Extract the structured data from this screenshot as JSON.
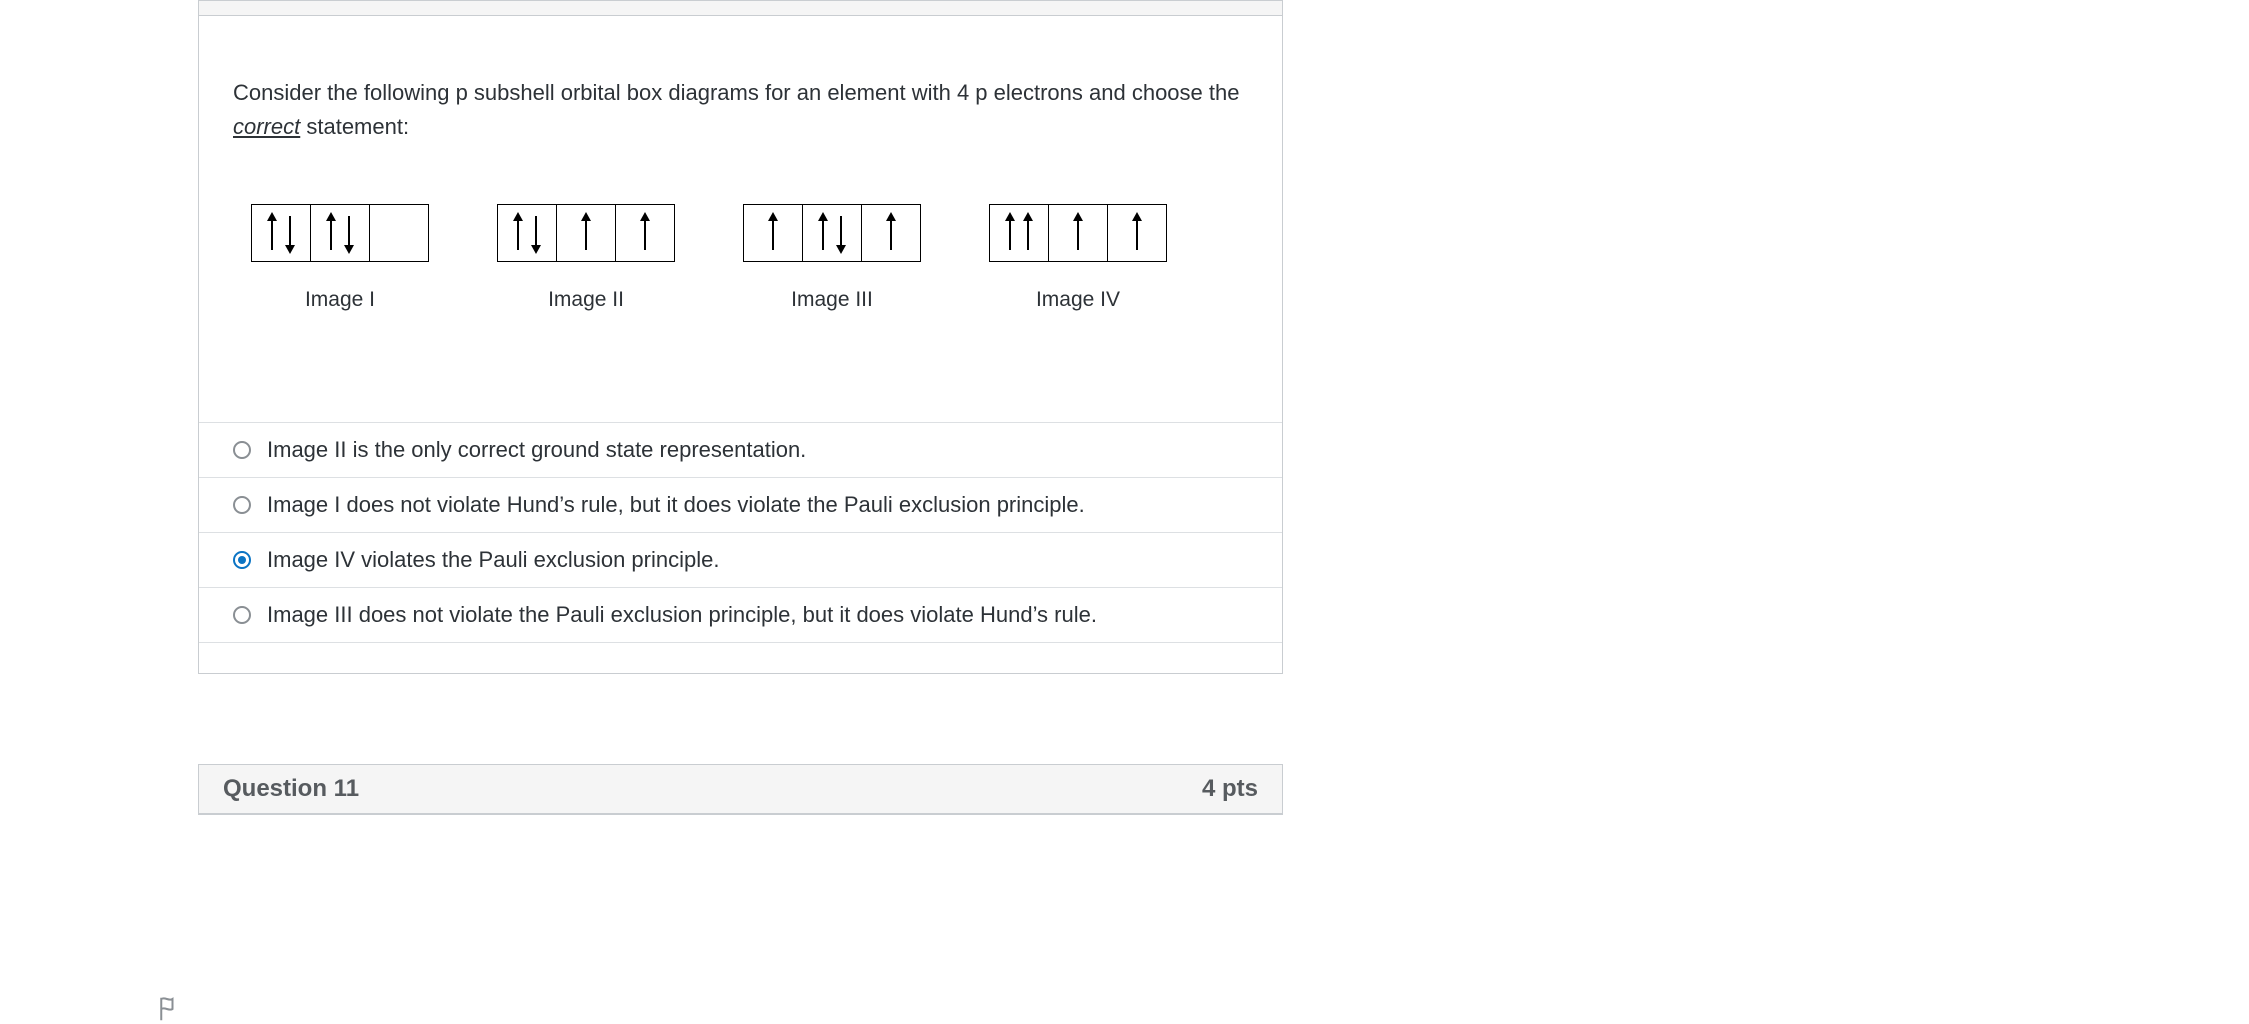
{
  "question": {
    "prompt_part1": "Consider the following p subshell orbital box diagrams for an element with 4 p electrons and choose the ",
    "prompt_emph": "correct",
    "prompt_part2": " statement:",
    "diagrams": [
      {
        "label": "Image I",
        "orbitals": [
          [
            "up",
            "down"
          ],
          [
            "up",
            "down"
          ],
          []
        ]
      },
      {
        "label": "Image II",
        "orbitals": [
          [
            "up",
            "down"
          ],
          [
            "up"
          ],
          [
            "up"
          ]
        ]
      },
      {
        "label": "Image III",
        "orbitals": [
          [
            "up"
          ],
          [
            "up",
            "down"
          ],
          [
            "up"
          ]
        ]
      },
      {
        "label": "Image IV",
        "orbitals": [
          [
            "up",
            "up"
          ],
          [
            "up"
          ],
          [
            "up"
          ]
        ]
      }
    ],
    "options": [
      {
        "text": "Image II is the only correct ground state representation.",
        "selected": false
      },
      {
        "text": "Image I does not violate Hund’s rule, but it does violate the Pauli exclusion principle.",
        "selected": false
      },
      {
        "text": "Image IV violates the Pauli exclusion principle.",
        "selected": true
      },
      {
        "text": "Image III does not violate the Pauli exclusion principle, but it does violate Hund’s rule.",
        "selected": false
      }
    ]
  },
  "next_question": {
    "title": "Question 11",
    "points": "4 pts"
  }
}
